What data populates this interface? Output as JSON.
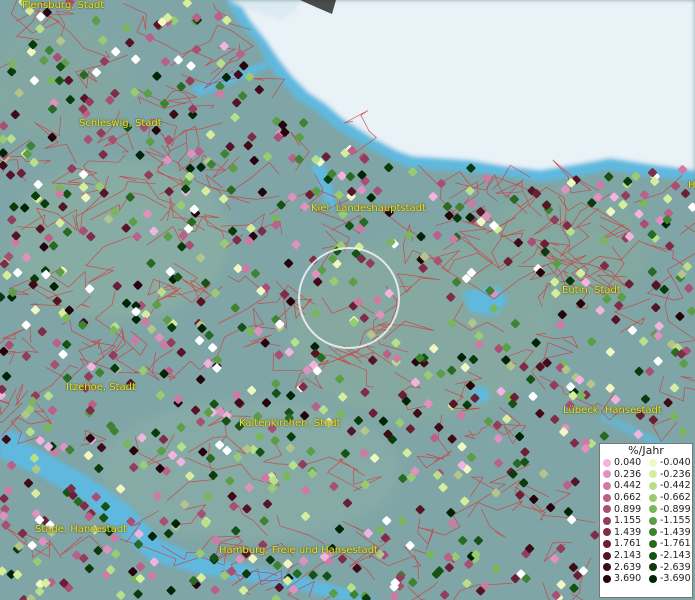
{
  "places": [
    {
      "name": "Flensburg, Stadt",
      "id": "flensburg"
    },
    {
      "name": "Schleswig, Stadt",
      "id": "schleswig"
    },
    {
      "name": "Kiel, Landeshauptstadt",
      "id": "kiel"
    },
    {
      "name": "Eutin, Stadt",
      "id": "eutin"
    },
    {
      "name": "Itzehoe, Stadt",
      "id": "itzehoe"
    },
    {
      "name": "Kaltenkirchen, Stadt",
      "id": "kaltenkirchen"
    },
    {
      "name": "Lübeck, Hansestadt",
      "id": "luebeck"
    },
    {
      "name": "Stade, Hansestadt",
      "id": "stade"
    },
    {
      "name": "Hamburg, Freie und Hansestadt",
      "id": "hamburg"
    },
    {
      "name": "H",
      "id": "edge-h"
    }
  ],
  "legend": {
    "title": "%/Jahr",
    "positive": [
      {
        "label": "0.040",
        "color": "#f2b3de"
      },
      {
        "label": "0.236",
        "color": "#e191bf"
      },
      {
        "label": "0.442",
        "color": "#cf7aa4"
      },
      {
        "label": "0.662",
        "color": "#bb6089"
      },
      {
        "label": "0.899",
        "color": "#a84f73"
      },
      {
        "label": "1.155",
        "color": "#923d5c"
      },
      {
        "label": "1.439",
        "color": "#7f2c48"
      },
      {
        "label": "1.761",
        "color": "#6b1f36"
      },
      {
        "label": "2.143",
        "color": "#561526"
      },
      {
        "label": "2.639",
        "color": "#3f0b18"
      },
      {
        "label": "3.690",
        "color": "#26040c"
      }
    ],
    "negative": [
      {
        "label": "-0.040",
        "color": "#f1f7c2"
      },
      {
        "label": "-0.236",
        "color": "#d6ee9c"
      },
      {
        "label": "-0.442",
        "color": "#b8e08a"
      },
      {
        "label": "-0.662",
        "color": "#98cc72"
      },
      {
        "label": "-0.899",
        "color": "#79b65c"
      },
      {
        "label": "-1.155",
        "color": "#5b9e46"
      },
      {
        "label": "-1.439",
        "color": "#3f8332"
      },
      {
        "label": "-1.761",
        "color": "#286a22"
      },
      {
        "label": "-2.143",
        "color": "#165216"
      },
      {
        "label": "-2.639",
        "color": "#0a3b0c"
      },
      {
        "label": "-3.690",
        "color": "#022406"
      }
    ]
  },
  "colors": {
    "land": "#7fa5a6",
    "sea": "#e9f2f7",
    "water": "#5fb9df",
    "boundary": "#d23a3a",
    "place_label": "#f2e21a",
    "selection_ring": "#f0f0f0"
  }
}
